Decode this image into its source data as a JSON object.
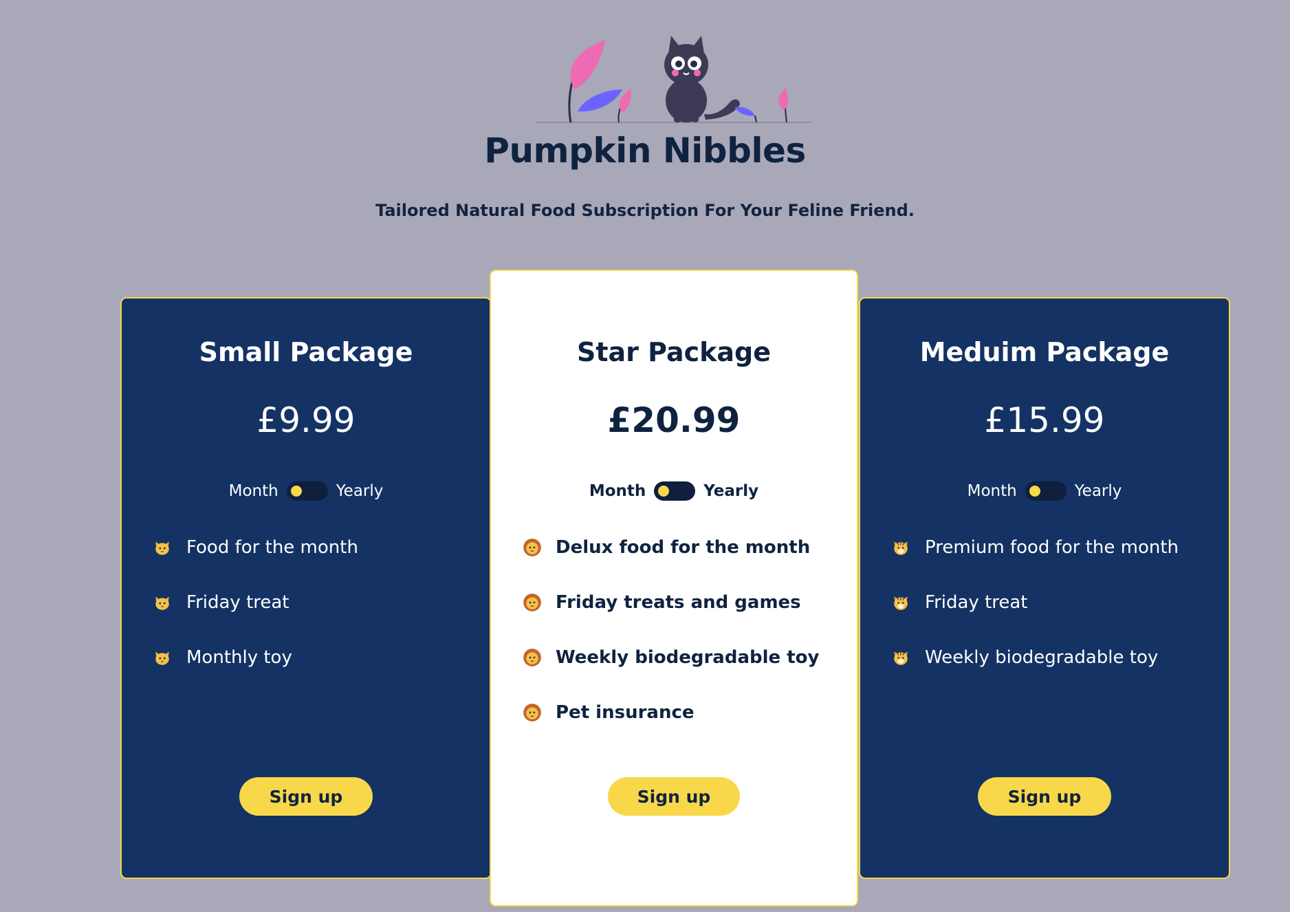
{
  "header": {
    "brand": "Pumpkin Nibbles",
    "tagline": "Tailored Natural Food Subscription For Your Feline Friend."
  },
  "colors": {
    "page_background": "#a9a8b8",
    "dark_card": "#143263",
    "light_card": "#ffffff",
    "accent_yellow": "#f8d84a",
    "navy_text": "#0f2340",
    "leaf_pink": "#ee6bb4",
    "leaf_purple": "#6c63ff"
  },
  "packages": [
    {
      "title": "Small Package",
      "price": "£9.99",
      "billing": {
        "left": "Month",
        "right": "Yearly"
      },
      "feature_icon": "cat-face-icon",
      "features": [
        "Food for the month",
        "Friday treat",
        "Monthly toy"
      ],
      "cta": "Sign up"
    },
    {
      "title": "Star Package",
      "price": "£20.99",
      "billing": {
        "left": "Month",
        "right": "Yearly"
      },
      "feature_icon": "lion-face-icon",
      "features": [
        "Delux food for the month",
        "Friday treats and games",
        "Weekly biodegradable toy",
        "Pet insurance"
      ],
      "cta": "Sign up"
    },
    {
      "title": "Meduim Package",
      "price": "£15.99",
      "billing": {
        "left": "Month",
        "right": "Yearly"
      },
      "feature_icon": "tiger-face-icon",
      "features": [
        "Premium food for the month",
        "Friday treat",
        "Weekly biodegradable toy"
      ],
      "cta": "Sign up"
    }
  ]
}
